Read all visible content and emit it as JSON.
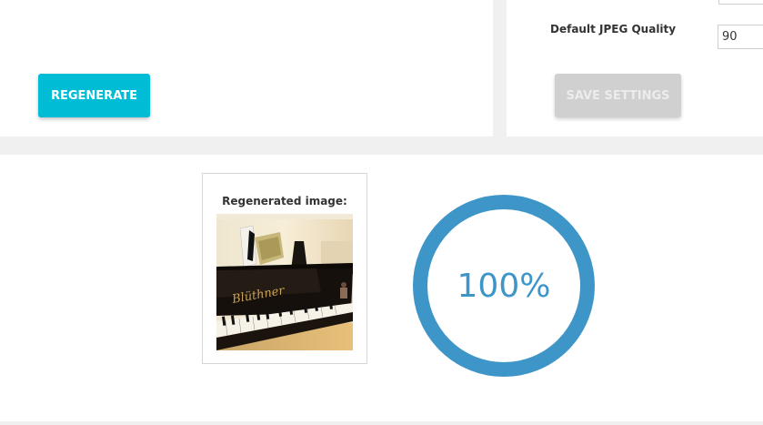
{
  "actions": {
    "regenerate_label": "REGENERATE"
  },
  "settings": {
    "jpeg_quality_label": "Default JPEG Quality",
    "jpeg_quality_value": "90",
    "save_label": "SAVE SETTINGS"
  },
  "result": {
    "title": "Regenerated image:",
    "image_icon": "grand-piano-photo"
  },
  "progress": {
    "value": 1.0,
    "label": "100%",
    "color": "#3e95c8"
  },
  "colors": {
    "primary_button": "#00bcd4",
    "disabled_button": "#d0d0d0",
    "background": "#f0f0f0"
  }
}
